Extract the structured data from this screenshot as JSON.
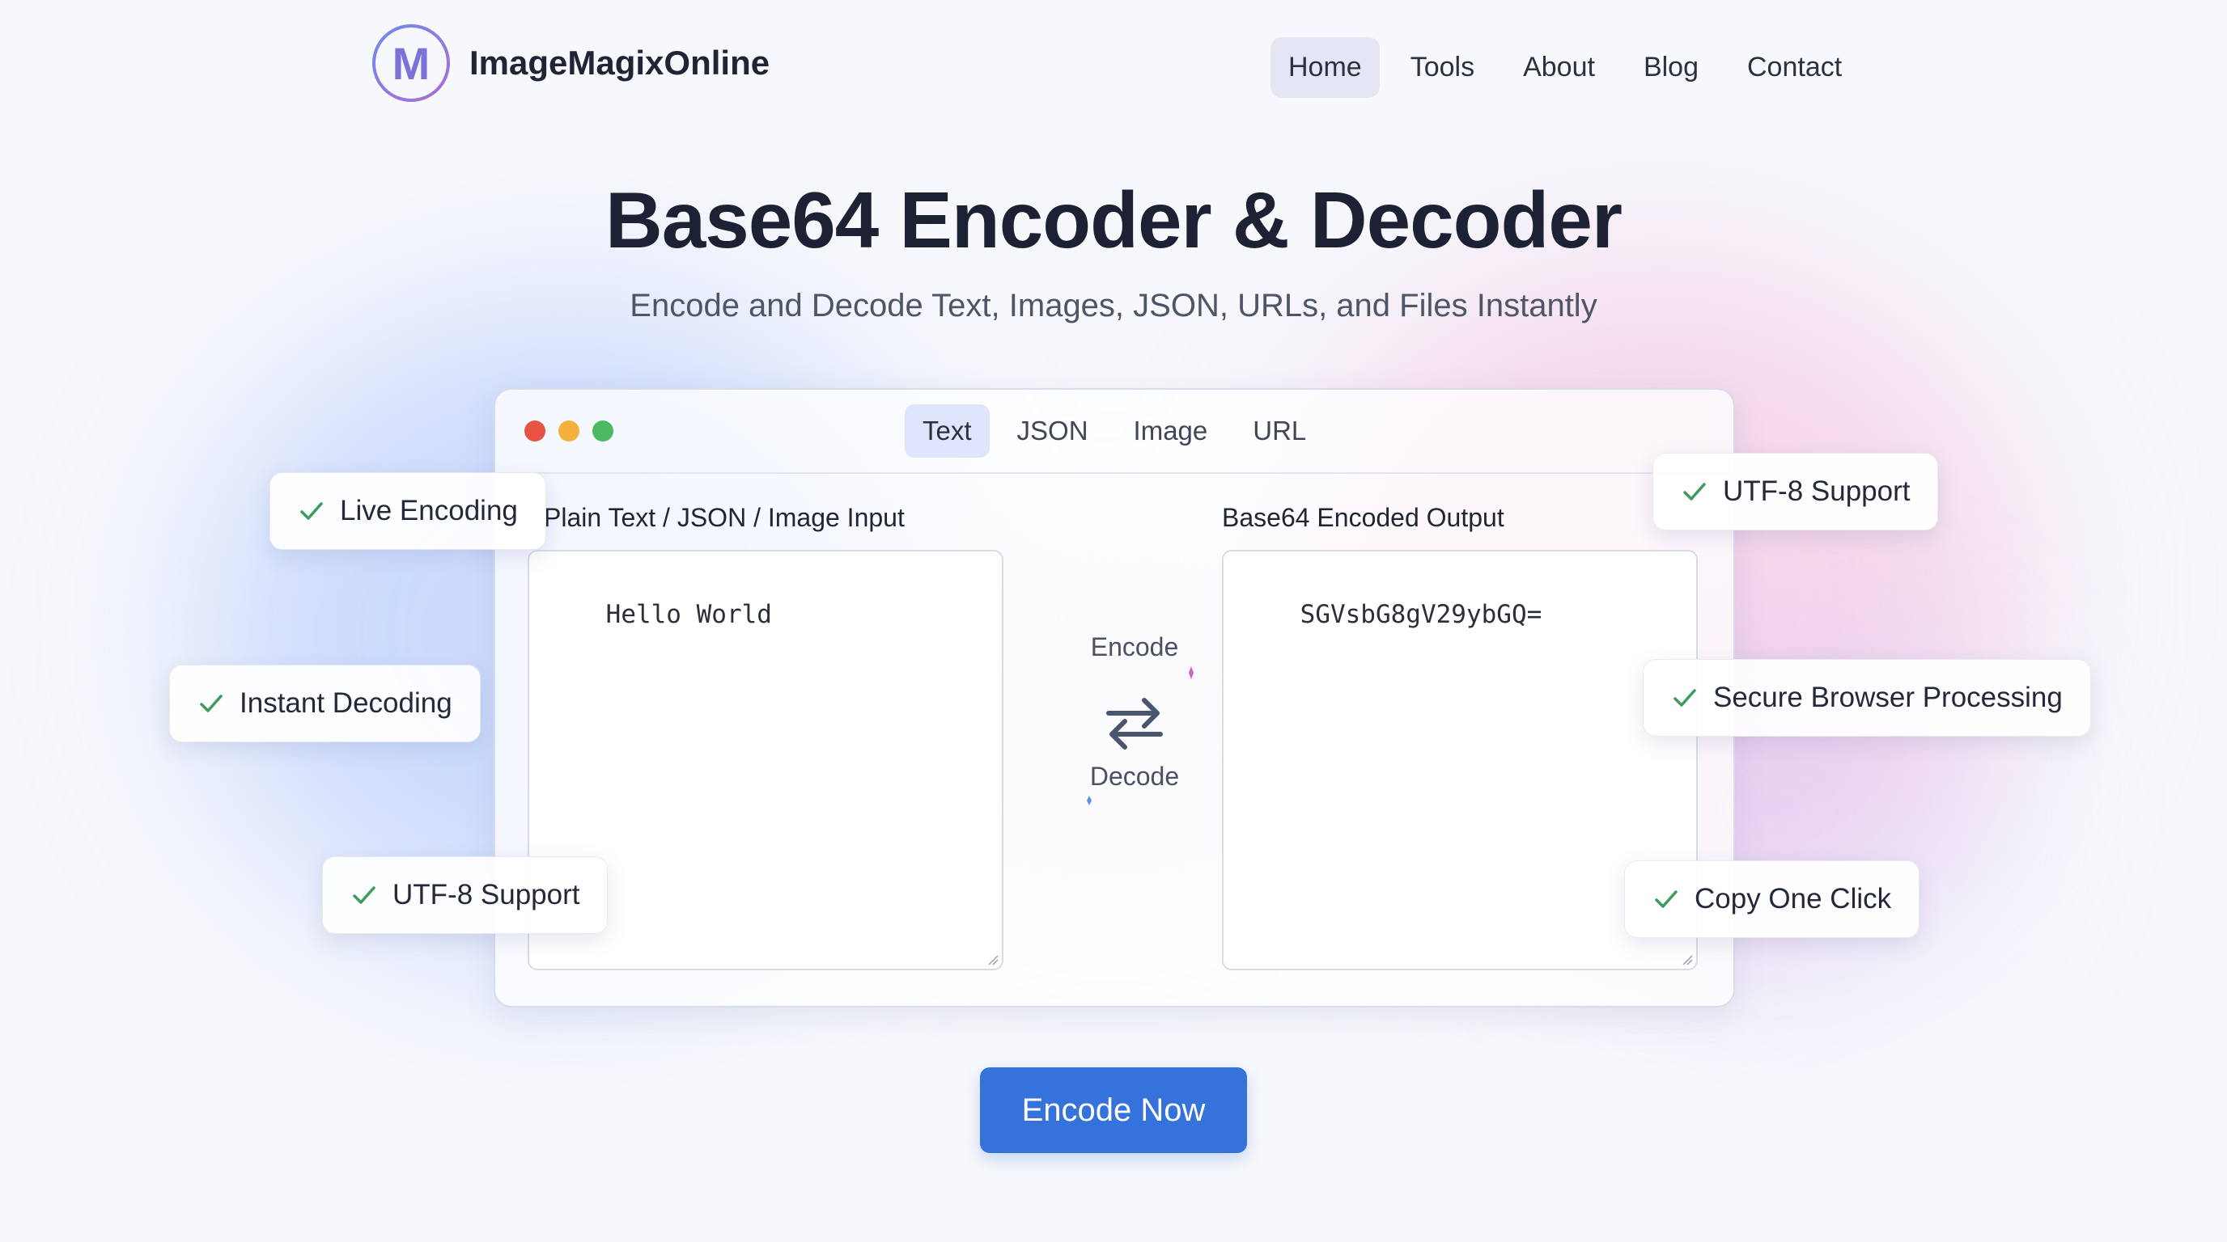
{
  "brand": {
    "logo_letter": "M",
    "name": "ImageMagixOnline"
  },
  "nav": {
    "items": [
      {
        "label": "Home",
        "active": true
      },
      {
        "label": "Tools"
      },
      {
        "label": "About"
      },
      {
        "label": "Blog"
      },
      {
        "label": "Contact"
      }
    ]
  },
  "hero": {
    "title": "Base64 Encoder & Decoder",
    "subtitle": "Encode and Decode Text, Images, JSON, URLs, and Files Instantly"
  },
  "tool": {
    "tabs": [
      {
        "label": "Text",
        "active": true
      },
      {
        "label": "JSON"
      },
      {
        "label": "Image"
      },
      {
        "label": "URL"
      }
    ],
    "input": {
      "label": "Plain Text / JSON / Image Input",
      "value": "Hello World"
    },
    "output": {
      "label": "Base64 Encoded Output",
      "value": "SGVsbG8gV29ybGQ="
    },
    "swap": {
      "encode_label": "Encode",
      "decode_label": "Decode",
      "icon": "swap-arrows-icon"
    }
  },
  "features": {
    "live_encoding": "Live Encoding",
    "instant_decoding": "Instant Decoding",
    "utf8_left": "UTF-8 Support",
    "utf8_right": "UTF-8 Support",
    "secure_processing": "Secure Browser Processing",
    "copy_one_click": "Copy One Click",
    "icon": "check-icon"
  },
  "cta": {
    "label": "Encode Now"
  },
  "colors": {
    "accent": "#3572db",
    "check": "#3e9a5e",
    "window_red": "#e95346",
    "window_yellow": "#f2b23b",
    "window_green": "#4cb863"
  }
}
